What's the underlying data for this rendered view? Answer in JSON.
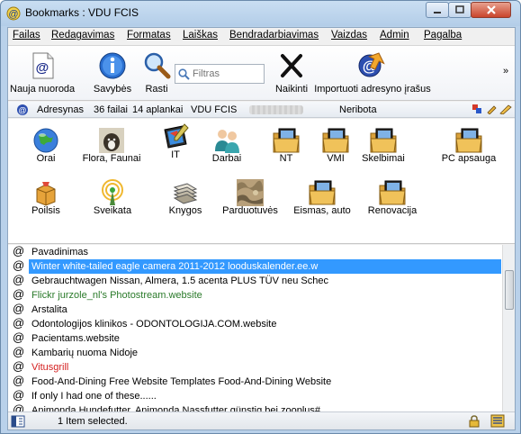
{
  "window": {
    "title": "Bookmarks : VDU FCIS",
    "controls": [
      "minimize",
      "maximize",
      "close"
    ]
  },
  "menubar": {
    "items": [
      {
        "label": "Failas"
      },
      {
        "label": "Redagavimas"
      },
      {
        "label": "Formatas"
      },
      {
        "label": "Laiškas"
      },
      {
        "label": "Bendradarbiavimas"
      },
      {
        "label": "Vaizdas"
      },
      {
        "label": "Admin"
      },
      {
        "label": "Pagalba"
      }
    ]
  },
  "toolbar": {
    "new_link": "Nauja nuoroda",
    "properties": "Savybės",
    "find": "Rasti",
    "filter_placeholder": "Filtras",
    "delete": "Naikinti",
    "import": "Importuoti adresyno įrašus",
    "more": "»"
  },
  "pathbar": {
    "name": "Adresynas",
    "files": "36 failai",
    "folders": "14 aplankai",
    "location": "VDU FCIS",
    "access": "Neribota"
  },
  "folders": [
    {
      "label": "Orai",
      "icon": "globe-icon"
    },
    {
      "label": "Flora, Faunai",
      "icon": "dog-icon"
    },
    {
      "label": "IT",
      "icon": "graphics-tablet-icon"
    },
    {
      "label": "Darbai",
      "icon": "people-icon"
    },
    {
      "label": "NT",
      "icon": "folder-monitor-icon"
    },
    {
      "label": "VMI",
      "icon": "folder-monitor-icon"
    },
    {
      "label": "Skelbimai",
      "icon": "folder-monitor-icon"
    },
    {
      "label": "PC apsauga",
      "icon": "folder-monitor-icon"
    },
    {
      "label": "Poilsis",
      "icon": "package-icon"
    },
    {
      "label": "Sveikata",
      "icon": "antenna-icon"
    },
    {
      "label": "Knygos",
      "icon": "stack-icon"
    },
    {
      "label": "Parduotuvės",
      "icon": "camo-icon"
    },
    {
      "label": "Eismas, auto",
      "icon": "folder-monitor-icon"
    },
    {
      "label": "Renovacija",
      "icon": "folder-monitor-icon"
    }
  ],
  "list": {
    "header": "Pavadinimas",
    "rows": [
      {
        "text": "Winter white-tailed eagle camera 2011-2012  looduskalender.ee.w",
        "color": "#000000",
        "selected": true
      },
      {
        "text": "Gebrauchtwagen Nissan, Almera, 1.5 acenta PLUS  TÜV neu  Schec",
        "color": "#000000",
        "selected": false
      },
      {
        "text": "Flickr jurzole_nl's Photostream.website",
        "color": "#2a7a2a",
        "selected": false
      },
      {
        "text": "Arstalita",
        "color": "#000000",
        "selected": false
      },
      {
        "text": "Odontologijos klinikos - ODONTOLOGIJA.COM.website",
        "color": "#000000",
        "selected": false
      },
      {
        "text": "Pacientams.website",
        "color": "#000000",
        "selected": false
      },
      {
        "text": "Kambarių nuoma Nidoje",
        "color": "#000000",
        "selected": false
      },
      {
        "text": "Vitusgrill",
        "color": "#d42020",
        "selected": false
      },
      {
        "text": "Food-And-Dining Free Website Templates  Food-And-Dining Website",
        "color": "#000000",
        "selected": false
      },
      {
        "text": " If only I had one of these......",
        "color": "#000000",
        "selected": false
      },
      {
        "text": "Animonda Hundefutter, Animonda Nassfutter günstig bei zooplus#",
        "color": "#000000",
        "selected": false
      }
    ]
  },
  "status": {
    "text": "1 Item selected."
  },
  "colors": {
    "selection": "#3399ff",
    "window_frame": "#b9d1ea"
  }
}
